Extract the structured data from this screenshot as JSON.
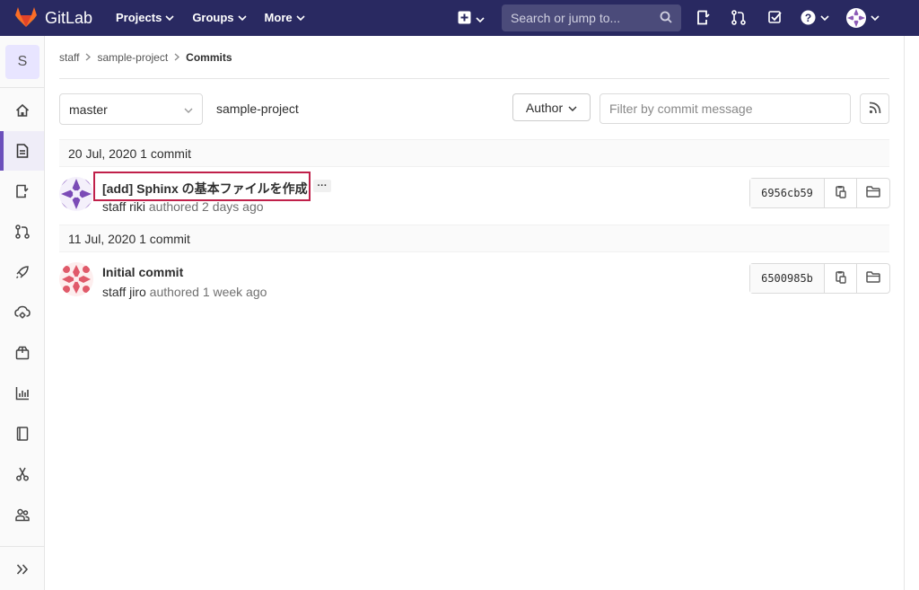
{
  "topbar": {
    "brand": "GitLab",
    "nav": [
      {
        "label": "Projects"
      },
      {
        "label": "Groups"
      },
      {
        "label": "More"
      }
    ],
    "search_placeholder": "Search or jump to..."
  },
  "sidebar": {
    "project_letter": "S",
    "items": [
      {
        "icon": "home-icon"
      },
      {
        "icon": "repository-icon"
      },
      {
        "icon": "issues-icon"
      },
      {
        "icon": "merge-request-icon"
      },
      {
        "icon": "rocket-icon"
      },
      {
        "icon": "cloud-gear-icon"
      },
      {
        "icon": "package-icon"
      },
      {
        "icon": "analytics-icon"
      },
      {
        "icon": "wiki-icon"
      },
      {
        "icon": "snippets-icon"
      },
      {
        "icon": "members-icon"
      },
      {
        "icon": "collapse-icon"
      }
    ]
  },
  "breadcrumb": [
    "staff",
    "sample-project",
    "Commits"
  ],
  "filters": {
    "branch": "master",
    "project": "sample-project",
    "author_label": "Author",
    "filter_placeholder": "Filter by commit message"
  },
  "days": [
    {
      "header": "20 Jul, 2020 1 commit",
      "commits": [
        {
          "title": "[add] Sphinx の基本ファイルを作成",
          "author": "staff riki",
          "meta": " authored 2 days ago",
          "sha": "6956cb59"
        }
      ]
    },
    {
      "header": "11 Jul, 2020 1 commit",
      "commits": [
        {
          "title": "Initial commit",
          "author": "staff jiro",
          "meta": " authored 1 week ago",
          "sha": "6500985b"
        }
      ]
    }
  ],
  "colors": {
    "navbar": "#292961",
    "accent": "#6b4fbb",
    "highlight": "#c0204a"
  }
}
